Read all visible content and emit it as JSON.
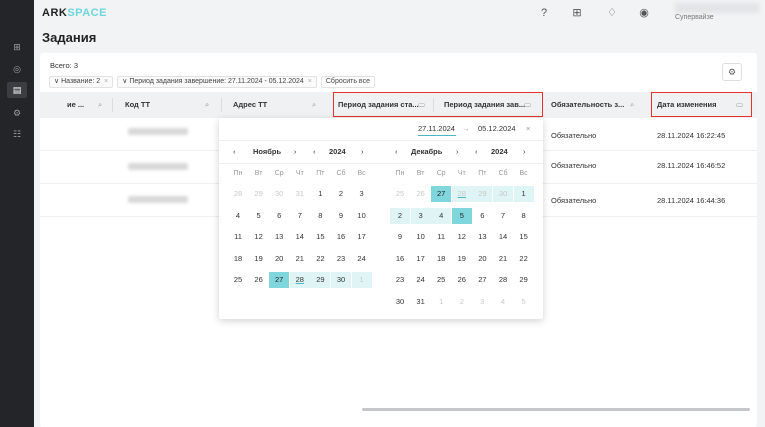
{
  "app": {
    "logo_ark": "ARK",
    "logo_space": "SP",
    "logo_space_a": "A",
    "logo_space_ce": "CE"
  },
  "header": {
    "user_role": "Супервайзе"
  },
  "page": {
    "title": "Задания"
  },
  "filters": {
    "total": "Всего: 3",
    "chips": [
      "Название: 2",
      "Период задания завершение: 27.11.2024 - 05.12.2024"
    ],
    "reset": "Сбросить все"
  },
  "table": {
    "headers": {
      "col1": "ие ...",
      "code": "Код ТТ",
      "address": "Адрес ТТ",
      "period_start": "Период задания ста...",
      "period_end": "Период задания зав...",
      "obligation": "Обязательность з...",
      "changed": "Дата изменения"
    },
    "rows": [
      {
        "obligation": "Обязательно",
        "changed": "28.11.2024 16:22:45"
      },
      {
        "obligation": "Обязательно",
        "changed": "28.11.2024 16:46:52"
      },
      {
        "obligation": "Обязательно",
        "changed": "28.11.2024 16:44:36"
      }
    ]
  },
  "picker": {
    "start": "27.11.2024",
    "end": "05.12.2024",
    "left": {
      "month": "Ноябрь",
      "year": "2024"
    },
    "right": {
      "month": "Декабрь",
      "year": "2024"
    },
    "weekdays": [
      "Пн",
      "Вт",
      "Ср",
      "Чт",
      "Пт",
      "Сб",
      "Вс"
    ],
    "left_days": [
      [
        "28",
        "o"
      ],
      [
        "29",
        "o"
      ],
      [
        "30",
        "o"
      ],
      [
        "31",
        "o"
      ],
      [
        "1",
        ""
      ],
      [
        "2",
        ""
      ],
      [
        "3",
        ""
      ],
      [
        "4",
        ""
      ],
      [
        "5",
        ""
      ],
      [
        "6",
        ""
      ],
      [
        "7",
        ""
      ],
      [
        "8",
        ""
      ],
      [
        "9",
        ""
      ],
      [
        "10",
        ""
      ],
      [
        "11",
        ""
      ],
      [
        "12",
        ""
      ],
      [
        "13",
        ""
      ],
      [
        "14",
        ""
      ],
      [
        "15",
        ""
      ],
      [
        "16",
        ""
      ],
      [
        "17",
        ""
      ],
      [
        "18",
        ""
      ],
      [
        "19",
        ""
      ],
      [
        "20",
        ""
      ],
      [
        "21",
        ""
      ],
      [
        "22",
        ""
      ],
      [
        "23",
        ""
      ],
      [
        "24",
        ""
      ],
      [
        "25",
        ""
      ],
      [
        "26",
        ""
      ],
      [
        "27",
        "s"
      ],
      [
        "28",
        "rt"
      ],
      [
        "29",
        "r"
      ],
      [
        "30",
        "r"
      ],
      [
        "1",
        "or"
      ]
    ],
    "right_days": [
      [
        "25",
        "o"
      ],
      [
        "26",
        "o"
      ],
      [
        "27",
        "os"
      ],
      [
        "28",
        "ort"
      ],
      [
        "29",
        "or"
      ],
      [
        "30",
        "or"
      ],
      [
        "1",
        "r"
      ],
      [
        "2",
        "r"
      ],
      [
        "3",
        "r"
      ],
      [
        "4",
        "r"
      ],
      [
        "5",
        "s"
      ],
      [
        "6",
        ""
      ],
      [
        "7",
        ""
      ],
      [
        "8",
        ""
      ],
      [
        "9",
        ""
      ],
      [
        "10",
        ""
      ],
      [
        "11",
        ""
      ],
      [
        "12",
        ""
      ],
      [
        "13",
        ""
      ],
      [
        "14",
        ""
      ],
      [
        "15",
        ""
      ],
      [
        "16",
        ""
      ],
      [
        "17",
        ""
      ],
      [
        "18",
        ""
      ],
      [
        "19",
        ""
      ],
      [
        "20",
        ""
      ],
      [
        "21",
        ""
      ],
      [
        "22",
        ""
      ],
      [
        "23",
        ""
      ],
      [
        "24",
        ""
      ],
      [
        "25",
        ""
      ],
      [
        "26",
        ""
      ],
      [
        "27",
        ""
      ],
      [
        "28",
        ""
      ],
      [
        "29",
        ""
      ],
      [
        "30",
        ""
      ],
      [
        "31",
        ""
      ],
      [
        "1",
        "o"
      ],
      [
        "2",
        "o"
      ],
      [
        "3",
        "o"
      ],
      [
        "4",
        "o"
      ],
      [
        "5",
        "o"
      ]
    ]
  },
  "icons": {
    "sidebar": [
      "grid-icon",
      "database-icon",
      "tasks-icon",
      "settings-icon",
      "users-icon"
    ],
    "top": [
      "support-icon",
      "apps-icon",
      "bell-icon",
      "compass-icon"
    ]
  },
  "colors": {
    "accent": "#7fd6dc",
    "highlight": "#e5322d",
    "sidebar": "#232528"
  }
}
